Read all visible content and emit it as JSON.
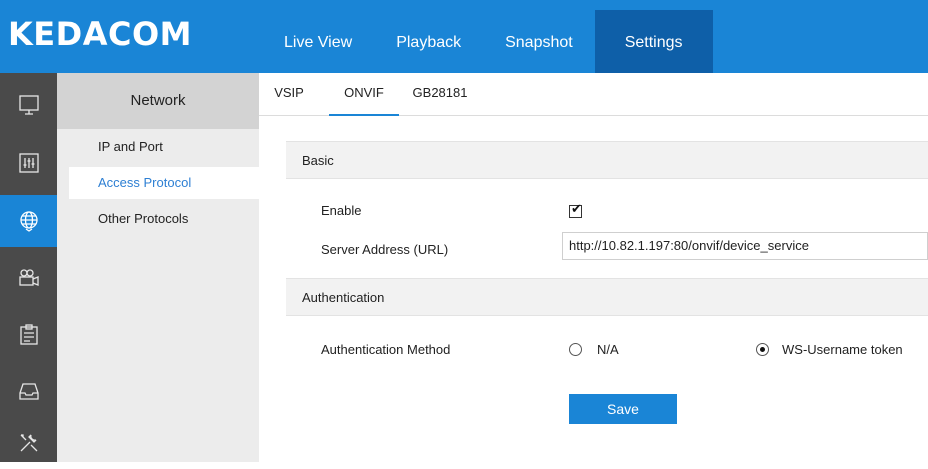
{
  "brand": {
    "logo_text": "KEDACOM",
    "accent_color": "#1a85d6",
    "active_nav_color": "#0e5fa8"
  },
  "top_nav": {
    "items": [
      {
        "label": "Live View"
      },
      {
        "label": "Playback"
      },
      {
        "label": "Snapshot"
      },
      {
        "label": "Settings",
        "active": true
      }
    ]
  },
  "rail": {
    "items": [
      {
        "icon": "monitor-icon"
      },
      {
        "icon": "sliders-icon"
      },
      {
        "icon": "globe-network-icon",
        "active": true
      },
      {
        "icon": "camera-icon"
      },
      {
        "icon": "clipboard-icon"
      },
      {
        "icon": "storage-tray-icon"
      },
      {
        "icon": "tools-icon"
      }
    ]
  },
  "subnav": {
    "title": "Network",
    "items": [
      {
        "label": "IP and Port"
      },
      {
        "label": "Access Protocol",
        "active": true
      },
      {
        "label": "Other Protocols"
      }
    ]
  },
  "tabs": [
    {
      "label": "VSIP"
    },
    {
      "label": "ONVIF",
      "active": true
    },
    {
      "label": "GB28181"
    }
  ],
  "basic": {
    "title": "Basic",
    "enable_label": "Enable",
    "enable_checked": true,
    "server_address_label": "Server Address (URL)",
    "server_address_value": "http://10.82.1.197:80/onvif/device_service"
  },
  "authentication": {
    "title": "Authentication",
    "method_label": "Authentication Method",
    "options": [
      {
        "label": "N/A",
        "selected": false
      },
      {
        "label": "WS-Username token",
        "selected": true
      }
    ]
  },
  "actions": {
    "save_label": "Save"
  }
}
